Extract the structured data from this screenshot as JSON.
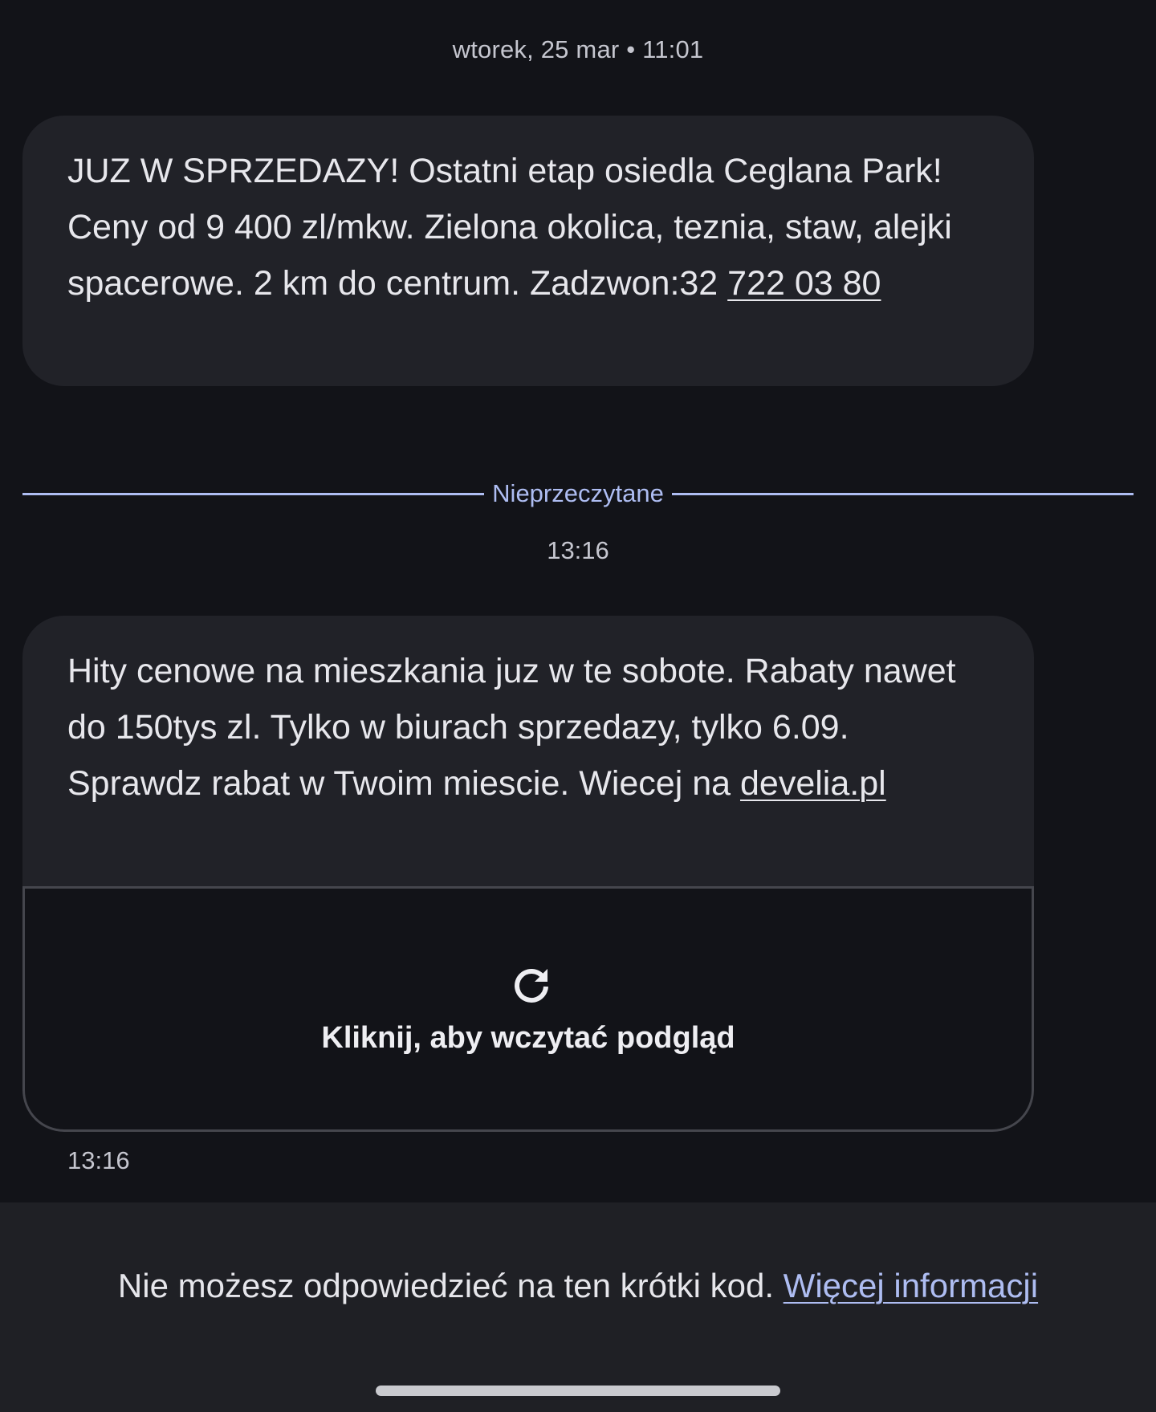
{
  "date_header": "wtorek, 25 mar • 11:01",
  "messages": [
    {
      "text_before": "JUZ W SPRZEDAZY! Ostatni etap osiedla Ceglana Park! Ceny od 9 400 zl/mkw. Zielona okolica, teznia, staw, alejki spacerowe. 2 km do centrum. Zadzwon:32 ",
      "link_text": "722 03 80"
    },
    {
      "text_before": "Hity cenowe na mieszkania juz w te sobote. Rabaty nawet do 150tys zl. Tylko w biurach sprzedazy, tylko 6.09. Sprawdz rabat w Twoim miescie. Wiecej na ",
      "link_text": "develia.pl",
      "preview_label": "Kliknij, aby wczytać podgląd",
      "preview_icon": "refresh-icon",
      "time": "13:16"
    }
  ],
  "unread_divider": "Nieprzeczytane",
  "unread_time": "13:16",
  "footer": {
    "text": "Nie możesz odpowiedzieć na ten krótki kod. ",
    "link": "Więcej informacji"
  },
  "colors": {
    "background": "#121318",
    "bubble": "#212228",
    "accent": "#aebdf2",
    "footer": "#1f2025"
  }
}
